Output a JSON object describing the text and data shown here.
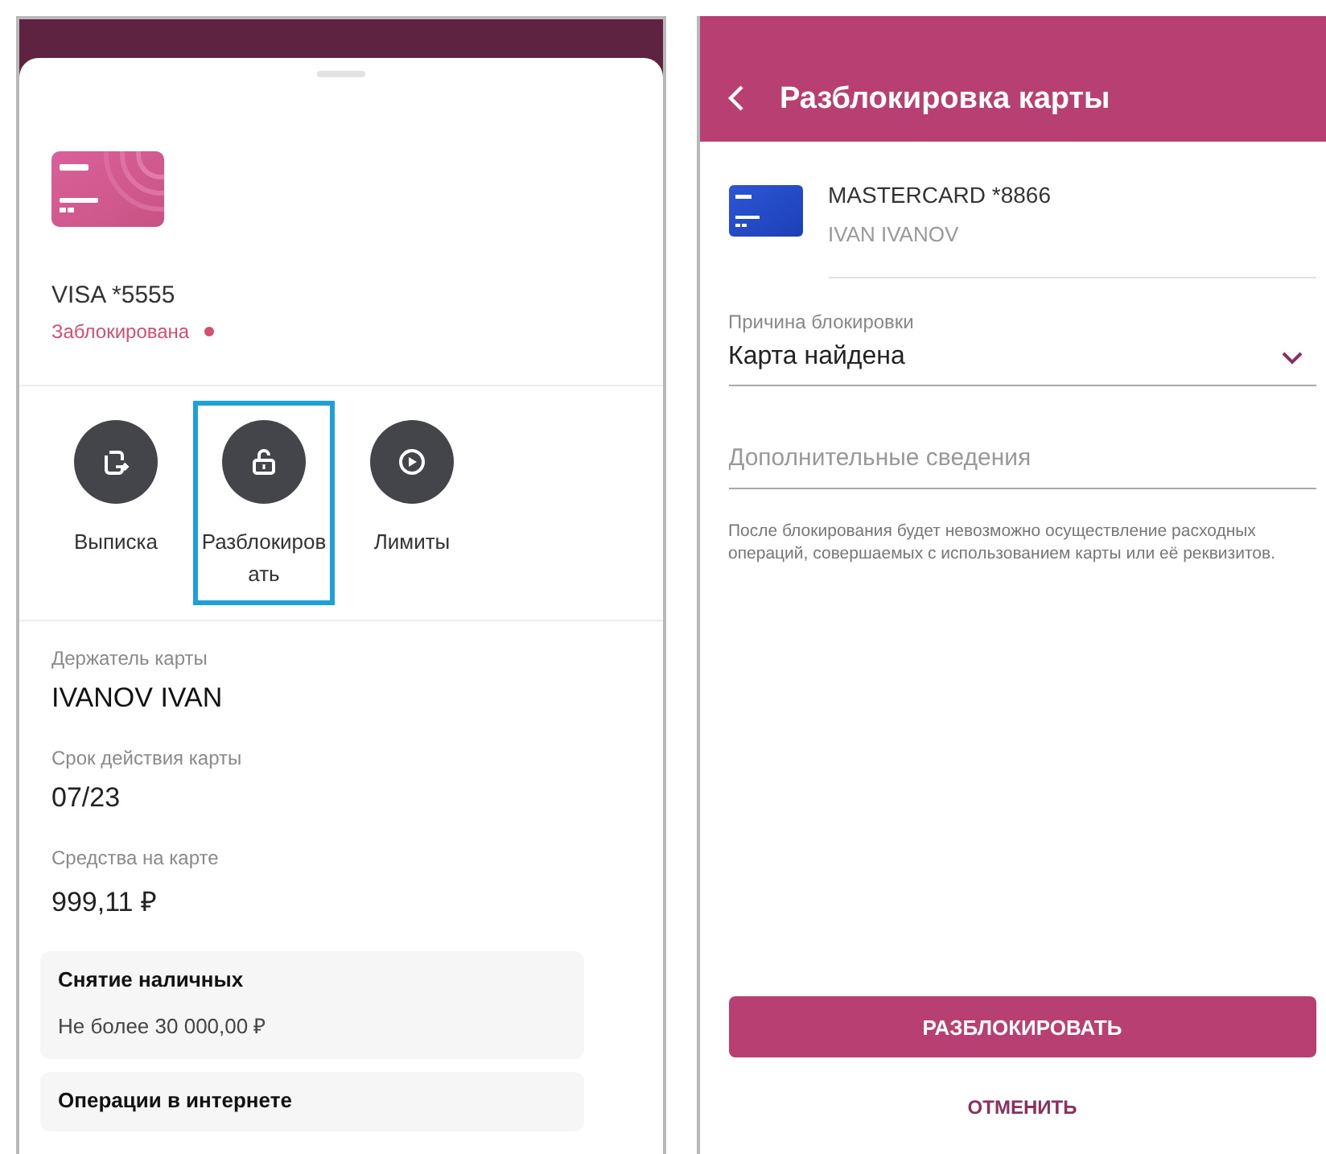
{
  "card_sheet": {
    "card": {
      "name": "VISA *5555",
      "status": "Заблокирована",
      "color": "#d4506f"
    },
    "actions": [
      {
        "kind": "statement",
        "label": "Выписка",
        "selected": false
      },
      {
        "kind": "unlock",
        "label": "Разблокировать",
        "selected": true
      },
      {
        "kind": "limits",
        "label": "Лимиты",
        "selected": false
      }
    ],
    "details": [
      {
        "label": "Держатель карты",
        "value": "IVANOV IVAN"
      },
      {
        "label": "Срок действия карты",
        "value": "07/23"
      },
      {
        "label": "Средства на карте",
        "value": "999,11 ₽"
      }
    ],
    "limits": [
      {
        "title": "Снятие наличных",
        "value": "Не более 30 000,00 ₽"
      },
      {
        "title": "Операции в интернете"
      }
    ]
  },
  "unlock_screen": {
    "title": "Разблокировка карты",
    "card": {
      "name": "MASTERCARD *8866",
      "holder": "IVAN IVANOV"
    },
    "reason": {
      "label": "Причина блокировки",
      "value": "Карта найдена"
    },
    "details_field": {
      "placeholder": "Дополнительные сведения"
    },
    "note": "После блокирования будет невозможно осуществление расходных операций, совершаемых с использованием карты или её реквизитов.",
    "buttons": [
      {
        "kind": "primary",
        "label": "РАЗБЛОКИРОВАТЬ"
      },
      {
        "kind": "text",
        "label": "ОТМЕНИТЬ"
      }
    ]
  }
}
